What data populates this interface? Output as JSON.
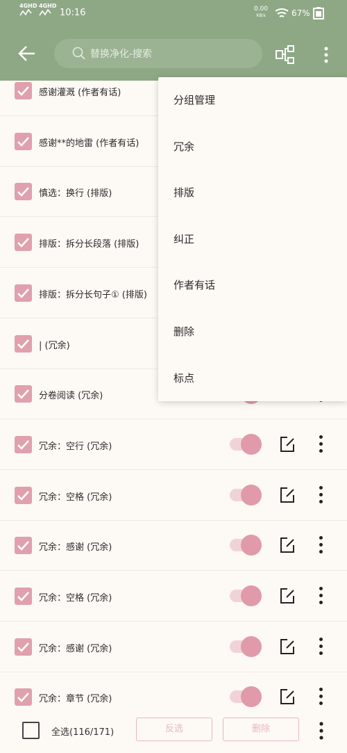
{
  "status_bar": {
    "signal1": "4GHD",
    "signal2": "4GHD",
    "time": "10:16",
    "net_speed": "0.00",
    "net_speed_unit": "KB/s",
    "battery": "67%"
  },
  "toolbar": {
    "search_placeholder": "替换净化-搜索"
  },
  "rows": [
    {
      "label": "感谢灌溉 (作者有话)",
      "checked": true,
      "enabled": true
    },
    {
      "label": "感谢**的地雷 (作者有话)",
      "checked": true,
      "enabled": true
    },
    {
      "label": "慎选：换行 (排版)",
      "checked": true,
      "enabled": true
    },
    {
      "label": "排版：拆分长段落 (排版)",
      "checked": true,
      "enabled": true
    },
    {
      "label": "排版：拆分长句子① (排版)",
      "checked": true,
      "enabled": true
    },
    {
      "label": "| (冗余)",
      "checked": true,
      "enabled": true
    },
    {
      "label": "分卷阅读 (冗余)",
      "checked": true,
      "enabled": true
    },
    {
      "label": "冗余：空行 (冗余)",
      "checked": true,
      "enabled": true
    },
    {
      "label": "冗余：空格 (冗余)",
      "checked": true,
      "enabled": true
    },
    {
      "label": "冗余：感谢 (冗余)",
      "checked": true,
      "enabled": true
    },
    {
      "label": "冗余：空格  (冗余)",
      "checked": true,
      "enabled": true
    },
    {
      "label": "冗余：感谢 (冗余)",
      "checked": true,
      "enabled": true
    },
    {
      "label": "冗余：章节 (冗余)",
      "checked": true,
      "enabled": true
    }
  ],
  "menu": {
    "items": [
      "分组管理",
      "冗余",
      "排版",
      "纠正",
      "作者有话",
      "删除",
      "标点"
    ]
  },
  "bottom_bar": {
    "select_all_label": "全选(116/171)",
    "invert_label": "反选",
    "delete_label": "删除"
  },
  "colors": {
    "toolbar": "#8ea885",
    "accent": "#e0a0ad",
    "background": "#fdf9f5"
  }
}
